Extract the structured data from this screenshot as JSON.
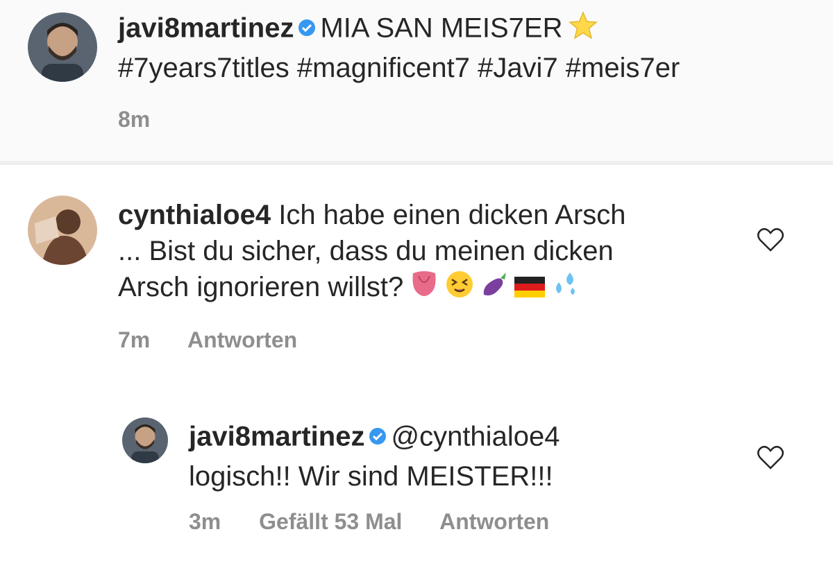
{
  "caption": {
    "username": "javi8martinez",
    "line1": "MIA SAN MEIS7ER",
    "line2": "#7years7titles #magnificent7 #Javi7 #meis7er",
    "time": "8m",
    "star_icon": "star-icon"
  },
  "comment": {
    "username": "cynthialoe4",
    "line1": "Ich habe einen dicken Arsch",
    "line2": "... Bist du sicher, dass du meinen dicken",
    "line3": "Arsch ignorieren willst?",
    "emojis": [
      "tongue-icon",
      "dizzy-face-icon",
      "eggplant-icon",
      "germany-flag-icon",
      "sweat-droplets-icon"
    ],
    "time": "7m",
    "reply_label": "Antworten"
  },
  "reply": {
    "username": "javi8martinez",
    "mention": "@cynthialoe4",
    "text": "logisch!! Wir sind MEISTER!!!",
    "time": "3m",
    "likes": "Gefällt 53 Mal",
    "reply_label": "Antworten"
  },
  "colors": {
    "verified_blue": "#3897f0",
    "meta_gray": "#8e8e8e",
    "text": "#262626"
  }
}
